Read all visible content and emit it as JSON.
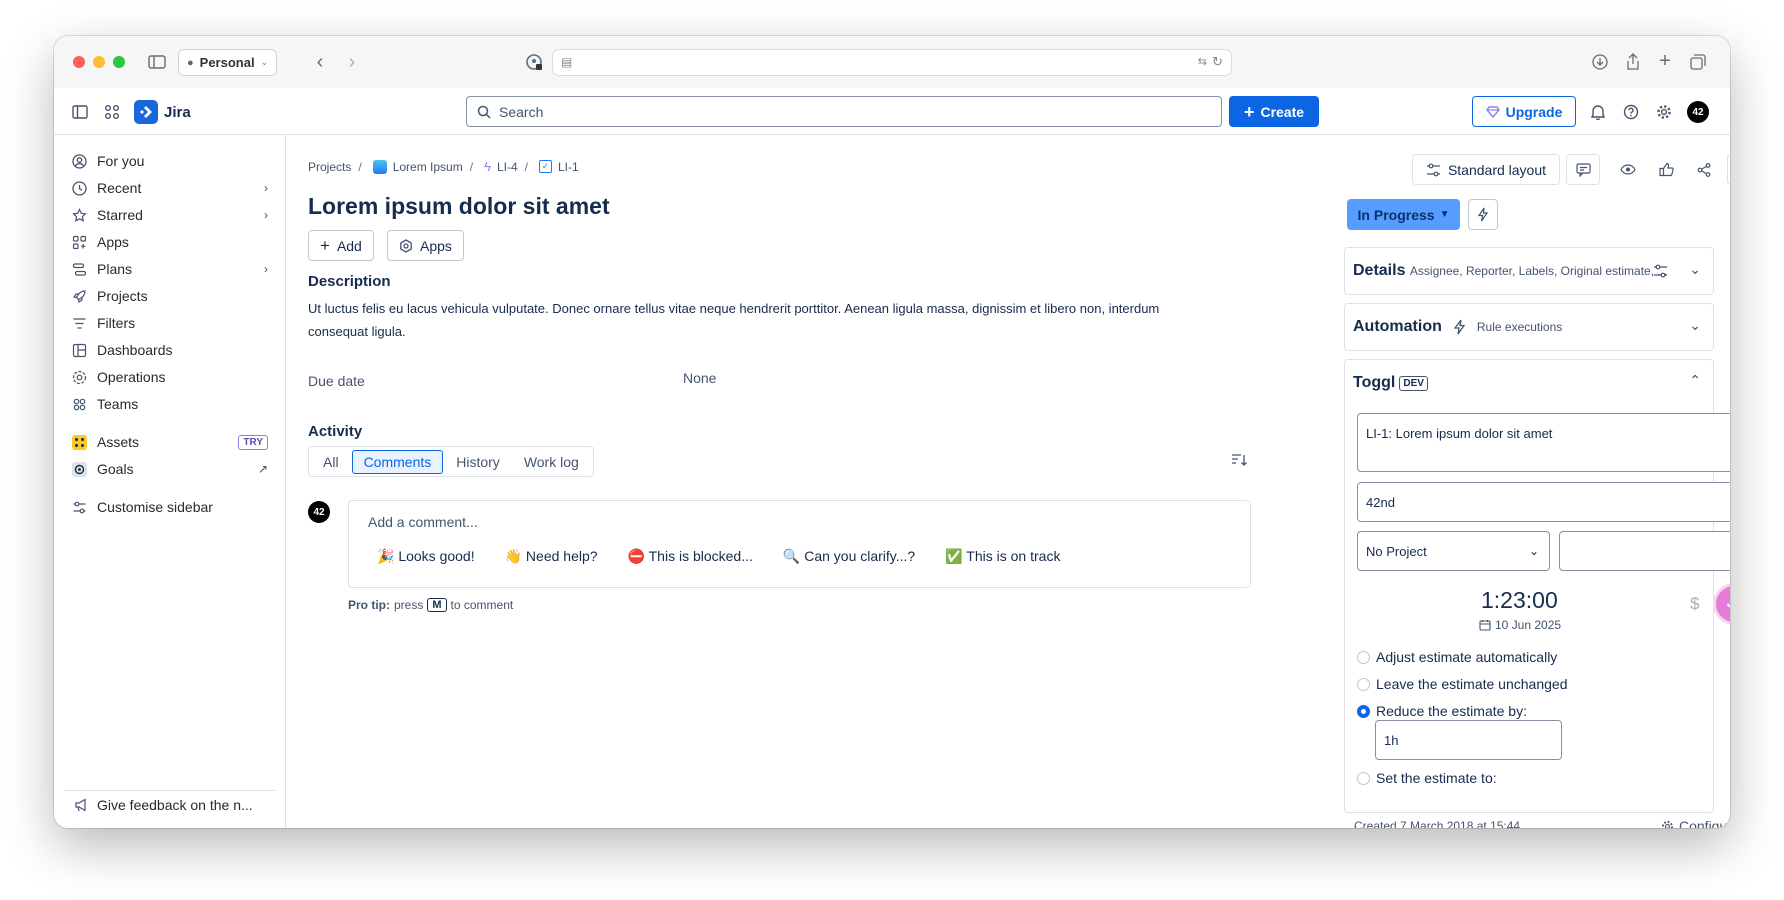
{
  "browser": {
    "profile_label": "Personal"
  },
  "topnav": {
    "app_name": "Jira",
    "search_placeholder": "Search",
    "create_label": "Create",
    "upgrade_label": "Upgrade"
  },
  "sidebar": {
    "items": [
      {
        "label": "For you",
        "icon": "person-icon"
      },
      {
        "label": "Recent",
        "icon": "clock-icon"
      },
      {
        "label": "Starred",
        "icon": "star-icon"
      },
      {
        "label": "Apps",
        "icon": "apps-icon"
      },
      {
        "label": "Plans",
        "icon": "plans-icon"
      },
      {
        "label": "Projects",
        "icon": "rocket-icon"
      },
      {
        "label": "Filters",
        "icon": "filter-icon"
      },
      {
        "label": "Dashboards",
        "icon": "dashboard-icon"
      },
      {
        "label": "Operations",
        "icon": "operations-icon"
      },
      {
        "label": "Teams",
        "icon": "teams-icon"
      },
      {
        "label": "Assets",
        "icon": "assets-icon"
      },
      {
        "label": "Goals",
        "icon": "goals-icon"
      },
      {
        "label": "Customise sidebar",
        "icon": "customise-icon"
      }
    ],
    "try_badge": "TRY",
    "feedback_label": "Give feedback on the n..."
  },
  "issue": {
    "breadcrumbs": [
      "Projects",
      "Lorem Ipsum",
      "LI-4",
      "LI-1"
    ],
    "title": "Lorem ipsum dolor sit amet",
    "add_label": "Add",
    "apps_label": "Apps",
    "description_heading": "Description",
    "description": "Ut luctus felis eu lacus vehicula vulputate. Donec ornare tellus vitae neque hendrerit porttitor. Aenean ligula massa, dignissim et libero non, interdum consequat ligula.",
    "due_date_label": "Due date",
    "due_date_value": "None",
    "activity_heading": "Activity",
    "tabs": [
      "All",
      "Comments",
      "History",
      "Work log"
    ],
    "active_tab": "Comments",
    "comment_placeholder": "Add a comment...",
    "quick_replies": [
      "🎉 Looks good!",
      "👋 Need help?",
      "⛔ This is blocked...",
      "🔍 Can you clarify...?",
      "✅ This is on track"
    ],
    "protip_prefix": "Pro tip:",
    "protip_press": "press",
    "protip_key": "M",
    "protip_suffix": "to comment"
  },
  "right": {
    "layout_label": "Standard layout",
    "status_label": "In Progress",
    "details_title": "Details",
    "details_sub": "Assignee, Reporter, Labels, Original estimate, ...",
    "automation_title": "Automation",
    "automation_sub": "Rule executions",
    "toggl_title": "Toggl",
    "toggl_badge": "DEV",
    "toggl_description": "LI-1: Lorem ipsum dolor sit amet",
    "workspace": "42nd",
    "project": "No Project",
    "tag": "",
    "timer": "1:23:00",
    "date": "10 Jun 2025",
    "estimate_options": [
      "Adjust estimate automatically",
      "Leave the estimate unchanged",
      "Reduce the estimate by:",
      "Set the estimate to:"
    ],
    "selected_option": "Reduce the estimate by:",
    "reduce_value": "1h",
    "created": "Created 7 March 2018 at 15:44",
    "configure_label": "Configure"
  },
  "colors": {
    "primary": "#0c66e4",
    "status": "#579dff",
    "toggl_pink": "#e57cd8"
  }
}
